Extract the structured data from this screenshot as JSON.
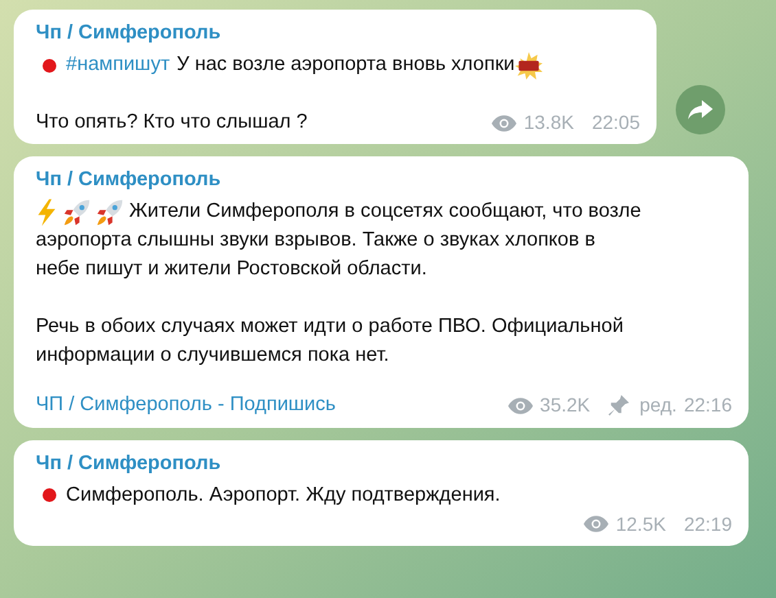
{
  "messages": [
    {
      "author": "Чп / Симферополь",
      "paragraphs": [
        [
          [
            {
              "kind": "dot"
            },
            {
              "kind": "link",
              "text": "#нампишут"
            },
            {
              "kind": "text",
              "text": "У нас возле аэропорта вновь хлопки"
            },
            {
              "kind": "boom"
            }
          ]
        ],
        [
          [
            {
              "kind": "text",
              "text": "Что опять? Кто что слышал ?"
            }
          ]
        ]
      ],
      "views": "13.8K",
      "time": "22:05",
      "share": true
    },
    {
      "author": "Чп / Симферополь",
      "paragraphs": [
        [
          [
            {
              "kind": "lightning"
            },
            {
              "kind": "rocket"
            },
            {
              "kind": "rocket"
            },
            {
              "kind": "text",
              "text": "Жители Симферополя в соцсетях сообщают, что возле"
            }
          ],
          [
            {
              "kind": "text",
              "text": "аэропорта слышны звуки взрывов. Также о звуках хлопков в"
            }
          ],
          [
            {
              "kind": "text",
              "text": "небе пишут и жители Ростовской области."
            }
          ]
        ],
        [
          [
            {
              "kind": "text",
              "text": "Речь в обоих случаях может идти о работе ПВО. Официальной"
            }
          ],
          [
            {
              "kind": "text",
              "text": "информации о случившемся пока нет."
            }
          ]
        ]
      ],
      "signature": "ЧП / Симферополь - Подпишись",
      "views": "35.2K",
      "pinned": true,
      "edited": "ред.",
      "time": "22:16",
      "share": false
    },
    {
      "author": "Чп / Симферополь",
      "paragraphs": [
        [
          [
            {
              "kind": "dot"
            },
            {
              "kind": "text",
              "text": "Симферополь. Аэропорт. Жду подтверждения."
            }
          ]
        ]
      ],
      "views": "12.5K",
      "time": "22:19",
      "share": false
    }
  ]
}
